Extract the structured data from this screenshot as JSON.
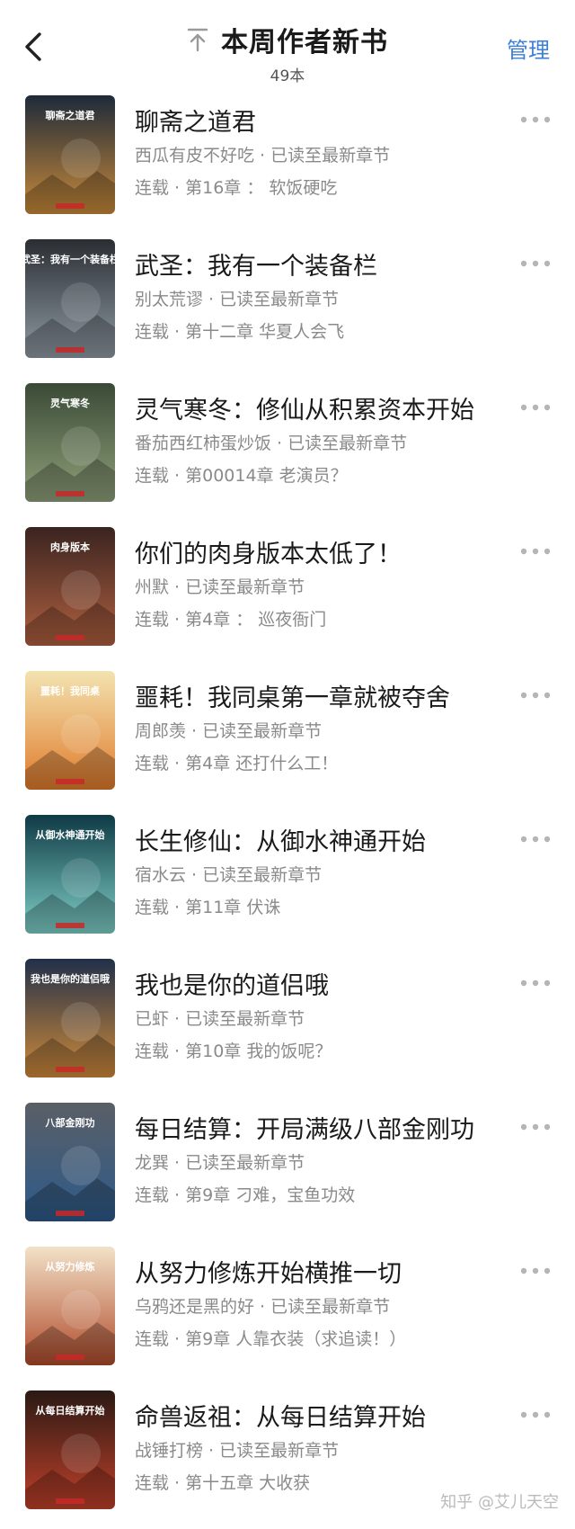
{
  "header": {
    "title": "本周作者新书",
    "count": "49本",
    "manage_label": "管理",
    "back_icon": "chevron-left-icon",
    "top_icon": "arrow-up-to-top-icon",
    "accent_color": "#3d7fd6"
  },
  "books": [
    {
      "title": "聊斋之道君",
      "author_status": "西瓜有皮不好吃 · 已读至最新章节",
      "chapter": "连载 · 第16章 ： 软饭硬吃",
      "cover_text": "聊斋之道君",
      "cover_colors": [
        "#1d2a3a",
        "#c98a3a"
      ]
    },
    {
      "title": "武圣：我有一个装备栏",
      "author_status": "别太荒谬 · 已读至最新章节",
      "chapter": "连载 · 第十二章 华夏人会飞",
      "cover_text": "武圣：我有一个装备栏",
      "cover_colors": [
        "#2a2e33",
        "#8f9aa3"
      ]
    },
    {
      "title": "灵气寒冬：修仙从积累资本开始",
      "author_status": "番茄西红柿蛋炒饭 · 已读至最新章节",
      "chapter": "连载 · 第00014章 老演员？",
      "cover_text": "灵气寒冬",
      "cover_colors": [
        "#3a4a36",
        "#8fa07a"
      ]
    },
    {
      "title": "你们的肉身版本太低了！",
      "author_status": "州默 · 已读至最新章节",
      "chapter": "连载 · 第4章 ： 巡夜衙门",
      "cover_text": "肉身版本",
      "cover_colors": [
        "#3a2420",
        "#b06040"
      ]
    },
    {
      "title": "噩耗！我同桌第一章就被夺舍",
      "author_status": "周郎羡 · 已读至最新章节",
      "chapter": "连载 · 第4章 还打什么工！",
      "cover_text": "噩耗！我同桌",
      "cover_colors": [
        "#f3e3b0",
        "#e07a2a"
      ]
    },
    {
      "title": "长生修仙：从御水神通开始",
      "author_status": "宿水云 · 已读至最新章节",
      "chapter": "连载 · 第11章 伏诛",
      "cover_text": "从御水神通开始",
      "cover_colors": [
        "#0f3a45",
        "#7fd0c8"
      ]
    },
    {
      "title": "我也是你的道侣哦",
      "author_status": "已虾 · 已读至最新章节",
      "chapter": "连载 · 第10章 我的饭呢？",
      "cover_text": "我也是你的道侣哦",
      "cover_colors": [
        "#20304a",
        "#d08a3a"
      ]
    },
    {
      "title": "每日结算：开局满级八部金刚功",
      "author_status": "龙巽 · 已读至最新章节",
      "chapter": "连载 · 第9章 刁难，宝鱼功效",
      "cover_text": "八部金刚功",
      "cover_colors": [
        "#5a5f66",
        "#2d5a8a"
      ]
    },
    {
      "title": "从努力修炼开始横推一切",
      "author_status": "乌鸦还是黑的好 · 已读至最新章节",
      "chapter": "连载 · 第9章 人靠衣装（求追读！）",
      "cover_text": "从努力修炼",
      "cover_colors": [
        "#f2e2c8",
        "#b04a2a"
      ]
    },
    {
      "title": "命兽返祖：从每日结算开始",
      "author_status": "战锤打榜 · 已读至最新章节",
      "chapter": "连载 · 第十五章 大收获",
      "cover_text": "从每日结算开始",
      "cover_colors": [
        "#2a1a14",
        "#c0402a"
      ]
    }
  ],
  "more_icon": "more-horizontal-icon",
  "watermark": "知乎 @艾儿天空"
}
